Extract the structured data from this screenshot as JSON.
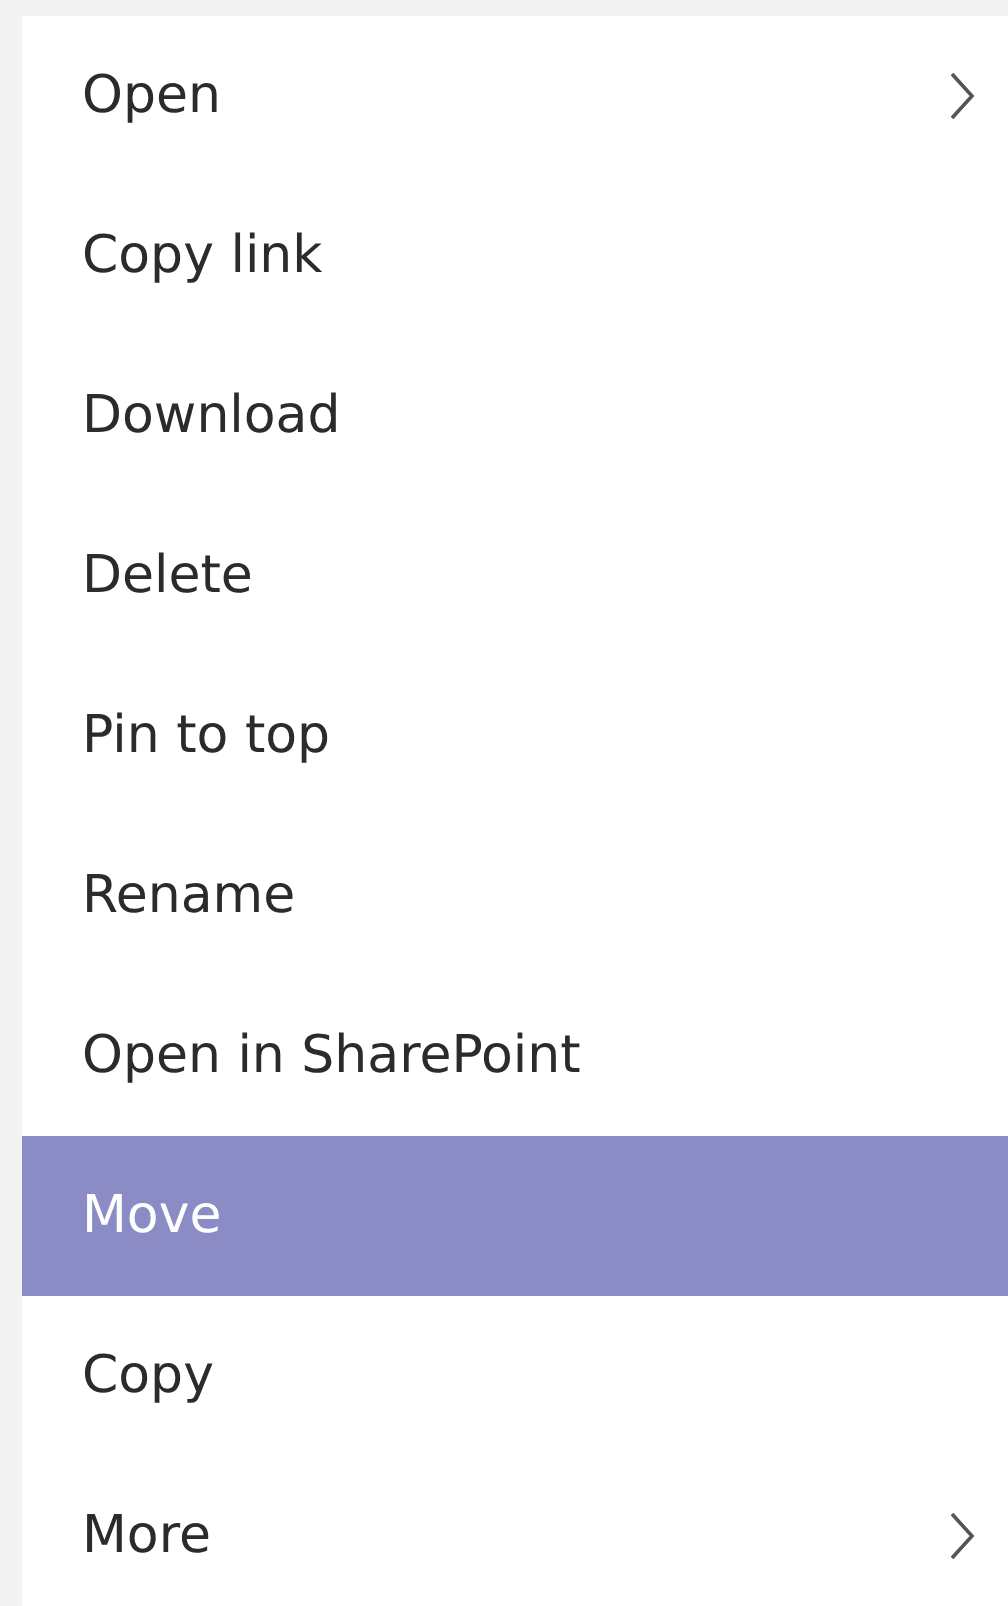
{
  "menu": {
    "items": [
      {
        "label": "Open",
        "has_submenu": true,
        "selected": false
      },
      {
        "label": "Copy link",
        "has_submenu": false,
        "selected": false
      },
      {
        "label": "Download",
        "has_submenu": false,
        "selected": false
      },
      {
        "label": "Delete",
        "has_submenu": false,
        "selected": false
      },
      {
        "label": "Pin to top",
        "has_submenu": false,
        "selected": false
      },
      {
        "label": "Rename",
        "has_submenu": false,
        "selected": false
      },
      {
        "label": "Open in SharePoint",
        "has_submenu": false,
        "selected": false
      },
      {
        "label": "Move",
        "has_submenu": false,
        "selected": true
      },
      {
        "label": "Copy",
        "has_submenu": false,
        "selected": false
      },
      {
        "label": "More",
        "has_submenu": true,
        "selected": false
      }
    ]
  }
}
